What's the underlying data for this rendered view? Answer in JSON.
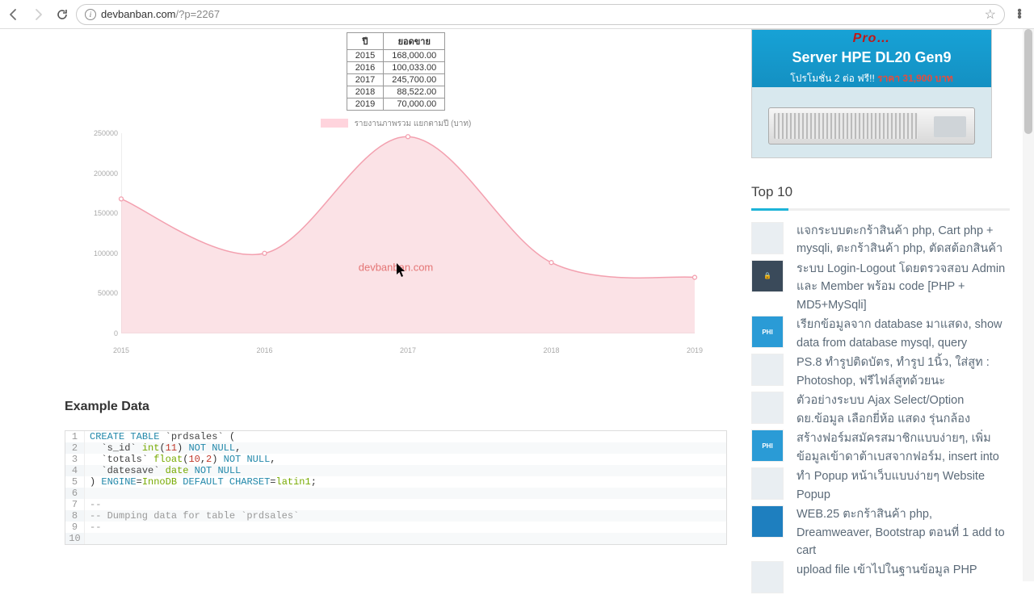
{
  "browser": {
    "url_host": "devbanban.com",
    "url_path": "/?p=2267"
  },
  "table": {
    "headers": [
      "ปี",
      "ยอดขาย"
    ],
    "rows": [
      [
        "2015",
        "168,000.00"
      ],
      [
        "2016",
        "100,033.00"
      ],
      [
        "2017",
        "245,700.00"
      ],
      [
        "2018",
        "88,522.00"
      ],
      [
        "2019",
        "70,000.00"
      ]
    ]
  },
  "chart_data": {
    "type": "area",
    "legend": "รายงานภาพรวม แยกตามปี (บาท)",
    "watermark": "devbanban.com",
    "x": [
      "2015",
      "2016",
      "2017",
      "2018",
      "2019"
    ],
    "values": [
      168000,
      100033,
      245700,
      88522,
      70000
    ],
    "ylim": [
      0,
      250000
    ],
    "yticks": [
      0,
      50000,
      100000,
      150000,
      200000,
      250000
    ],
    "fill": "#f8cad2",
    "stroke": "#f3a0af"
  },
  "example_heading": "Example Data",
  "code": [
    {
      "n": 1,
      "raw": "CREATE TABLE `prdsales` ("
    },
    {
      "n": 2,
      "raw": "  `s_id` int(11) NOT NULL,"
    },
    {
      "n": 3,
      "raw": "  `totals` float(10,2) NOT NULL,"
    },
    {
      "n": 4,
      "raw": "  `datesave` date NOT NULL"
    },
    {
      "n": 5,
      "raw": ") ENGINE=InnoDB DEFAULT CHARSET=latin1;"
    },
    {
      "n": 6,
      "raw": ""
    },
    {
      "n": 7,
      "raw": "--"
    },
    {
      "n": 8,
      "raw": "-- Dumping data for table `prdsales`"
    },
    {
      "n": 9,
      "raw": "--"
    },
    {
      "n": 10,
      "raw": ""
    }
  ],
  "promo": {
    "tag": "Pro…",
    "line1": "Server HPE DL20 Gen9",
    "line2a": "โปรโมชั่น 2 ต่อ ฟรี!!",
    "line2b": "ราคา 31,900 บาท"
  },
  "top10": {
    "title": "Top 10",
    "items": [
      "แจกระบบตะกร้าสินค้า php, Cart php + mysqli, ตะกร้าสินค้า php, ตัดสต้อกสินค้า",
      "ระบบ Login-Logout โดยตรวจสอบ Admin และ Member พร้อม code [PHP + MD5+MySqli]",
      "เรียกข้อมูลจาก database มาแสดง, show data from database mysql, query",
      "PS.8 ทำรูปติดบัตร, ทำรูป 1นิ้ว, ใส่สูท : Photoshop, ฟรีไฟล์สูทด้วยนะ",
      "ตัวอย่างระบบ Ajax Select/Option ดย.ข้อมูล เลือกยี่ห้อ แสดง รุ่นกล้อง",
      "สร้างฟอร์มสมัครสมาชิกแบบง่ายๆ, เพิ่มข้อมูลเข้าดาต้าเบสจากฟอร์ม, insert into",
      "ทำ Popup หน้าเว็บแบบง่ายๆ Website Popup",
      "WEB.25 ตะกร้าสินค้า php, Dreamweaver, Bootstrap ตอนที่ 1 add to cart",
      "upload file เข้าไปในฐานข้อมูล PHP"
    ]
  }
}
